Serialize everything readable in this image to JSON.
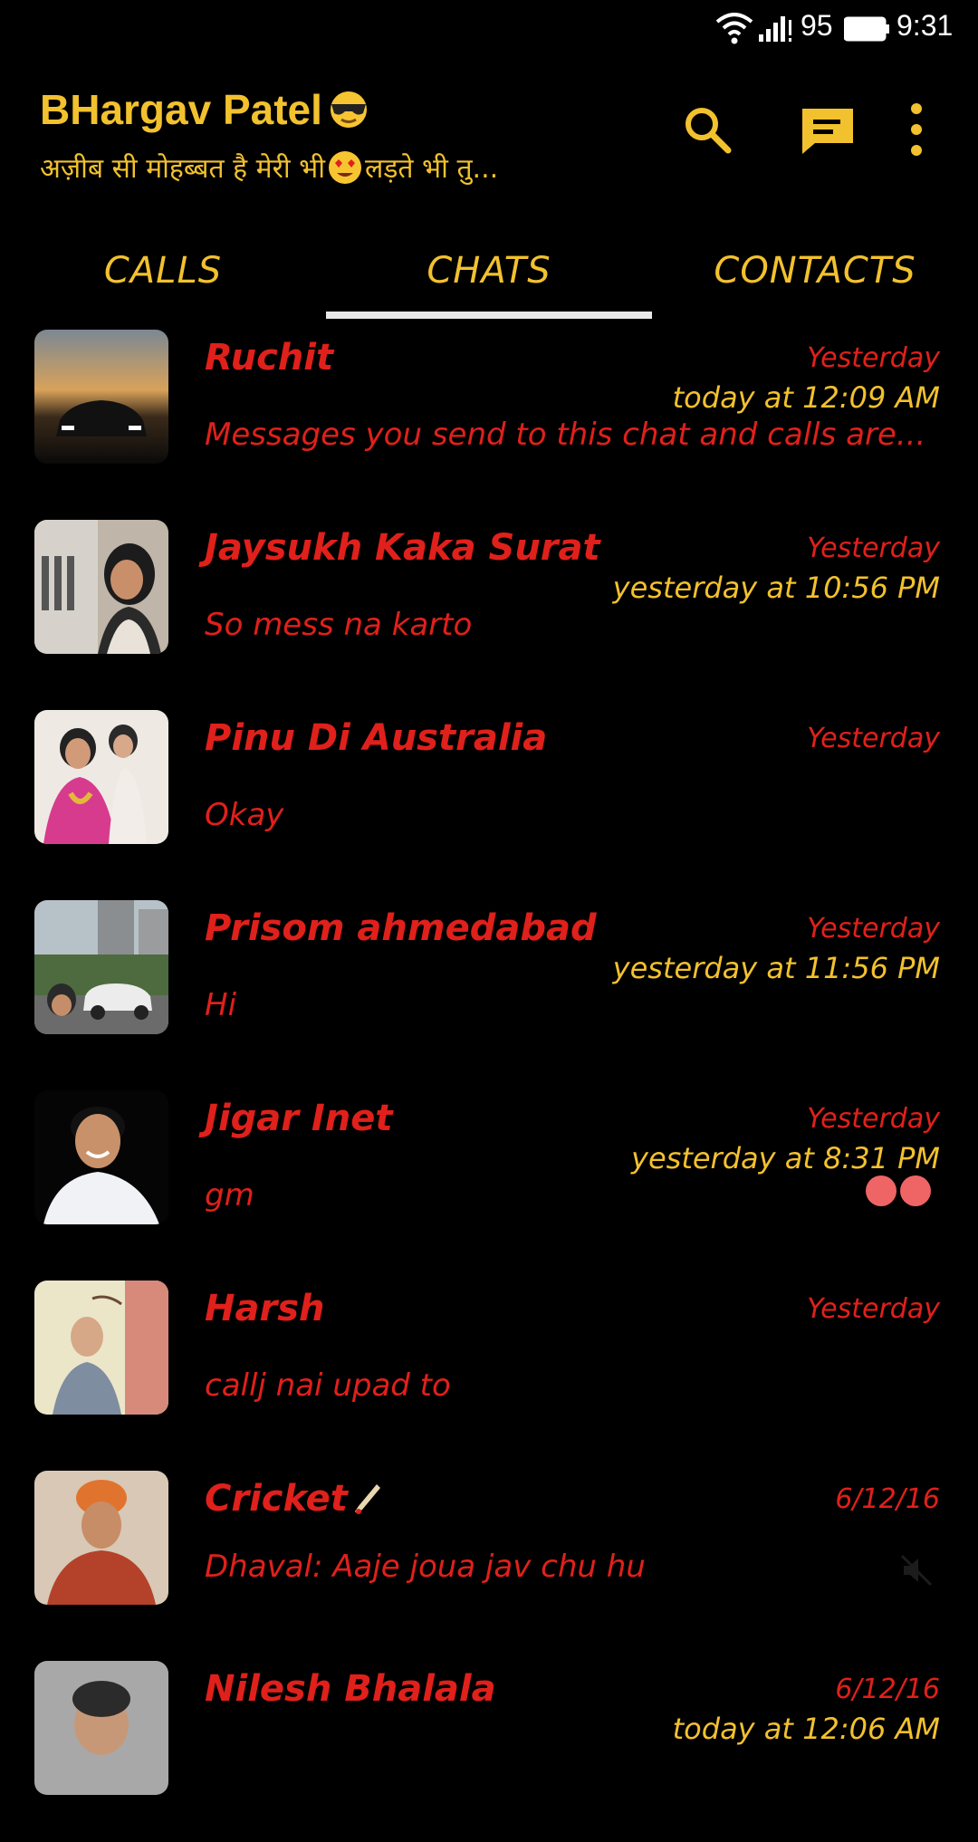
{
  "status_bar": {
    "battery_pct": "95",
    "time": "9:31"
  },
  "header": {
    "title": "BHargav Patel",
    "subtitle_part1": "अज़ीब सी मोहब्बत है मेरी भी",
    "subtitle_part2": "लड़ते भी तु..."
  },
  "tabs": [
    {
      "label": "CALLS"
    },
    {
      "label": "CHATS",
      "selected": true
    },
    {
      "label": "CONTACTS"
    }
  ],
  "chats": [
    {
      "name": "Ruchit",
      "date": "Yesterday",
      "seen": "today at 12:09 AM",
      "preview": "Messages you send to this chat and calls are..."
    },
    {
      "name": "Jaysukh Kaka Surat",
      "date": "Yesterday",
      "seen": "yesterday at 10:56 PM",
      "preview": "So mess na karto"
    },
    {
      "name": "Pinu Di Australia",
      "date": "Yesterday",
      "seen": "",
      "preview": "Okay"
    },
    {
      "name": "Prisom ahmedabad",
      "date": "Yesterday",
      "seen": "yesterday at 11:56 PM",
      "preview": "Hi"
    },
    {
      "name": "Jigar Inet",
      "date": "Yesterday",
      "seen": "yesterday at 8:31 PM",
      "preview": "gm",
      "unread": true
    },
    {
      "name": "Harsh",
      "date": "Yesterday",
      "seen": "",
      "preview": "callj nai upad to"
    },
    {
      "name": "Cricket",
      "date": "6/12/16",
      "seen": "",
      "preview": "Dhaval: Aaje joua jav chu hu",
      "muted": true
    },
    {
      "name": "Nilesh Bhalala",
      "date": "6/12/16",
      "seen": "today at 12:06 AM",
      "preview": ""
    }
  ],
  "colors": {
    "accent_yellow": "#f2c12e",
    "chat_red": "#e0201b",
    "background": "#000000",
    "unread_dot": "#ef6464"
  },
  "icons": [
    "wifi-icon",
    "signal-icon",
    "battery-icon",
    "search-icon",
    "compose-icon",
    "more-vert-icon",
    "mute-icon"
  ]
}
